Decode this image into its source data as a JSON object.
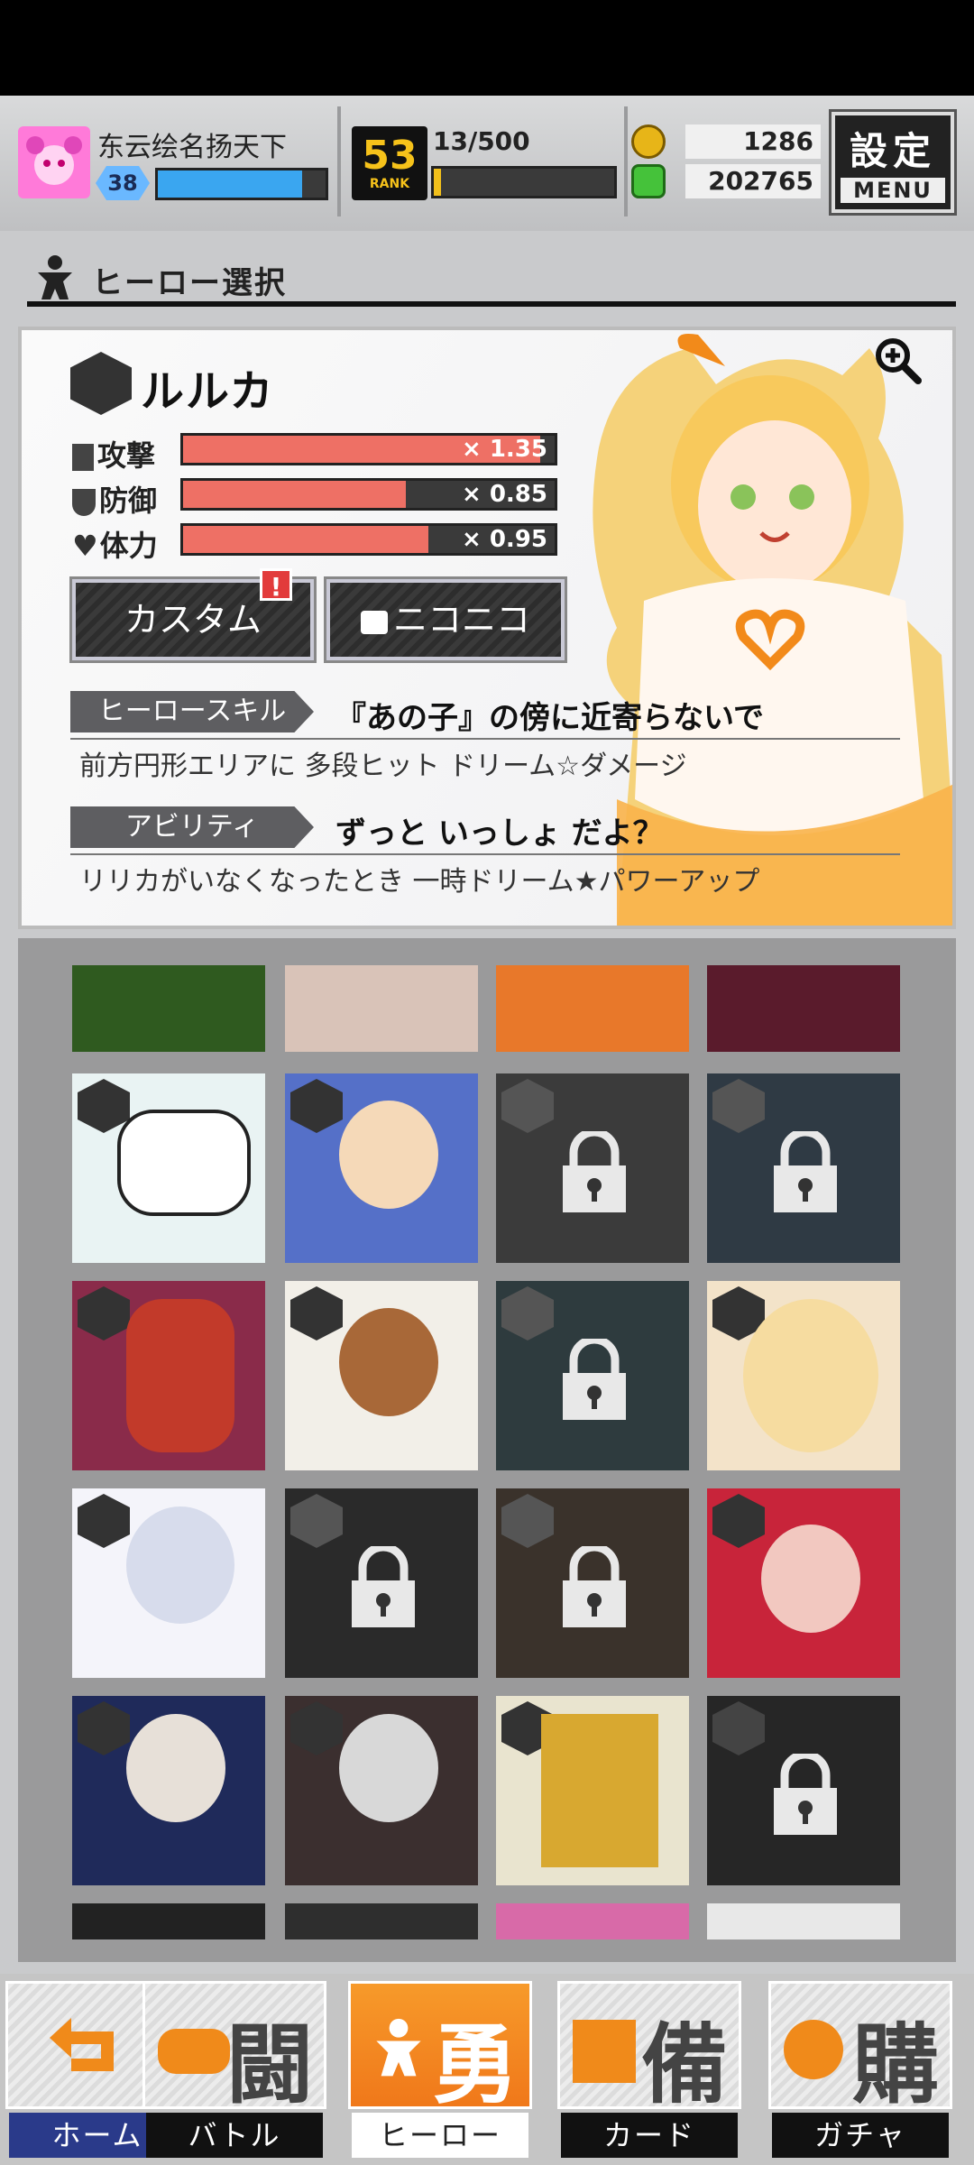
{
  "header": {
    "username": "东云绘名扬天下",
    "level": "38",
    "rank": "53",
    "rank_label": "RANK",
    "stamina": "13/500",
    "coins": "1286",
    "energy": "202765",
    "menu_top": "設定",
    "menu_bottom": "MENU"
  },
  "section": {
    "title": "ヒーロー選択"
  },
  "hero": {
    "name": "ルルカ",
    "stats": [
      {
        "label": "攻撃",
        "multiplier": "× 1.35",
        "fill": 0.96
      },
      {
        "label": "防御",
        "multiplier": "× 0.85",
        "fill": 0.6
      },
      {
        "label": "体力",
        "multiplier": "× 0.95",
        "fill": 0.66
      }
    ],
    "custom_label": "カスタム",
    "alert": "!",
    "nico_label": "ニコニコ",
    "skill_tag": "ヒーロースキル",
    "skill_name": "『あの子』の傍に近寄らないで",
    "skill_desc": "前方円形エリアに 多段ヒット ドリーム☆ダメージ",
    "ability_tag": "アビリティ",
    "ability_name": "ずっと いっしょ だよ？",
    "ability_desc": "リリカがいなくなったとき 一時ドリーム★パワーアップ"
  },
  "colors": {
    "accent": "#f0781a",
    "stat_bar": "#ee7065",
    "exp": "#3aa6f0",
    "rank": "#f6c21a"
  },
  "nav": [
    {
      "kanji": "",
      "label": "ホーム"
    },
    {
      "kanji": "闘",
      "label": "バトル"
    },
    {
      "kanji": "勇",
      "label": "ヒーロー"
    },
    {
      "kanji": "備",
      "label": "カード"
    },
    {
      "kanji": "購",
      "label": "ガチャ"
    }
  ]
}
